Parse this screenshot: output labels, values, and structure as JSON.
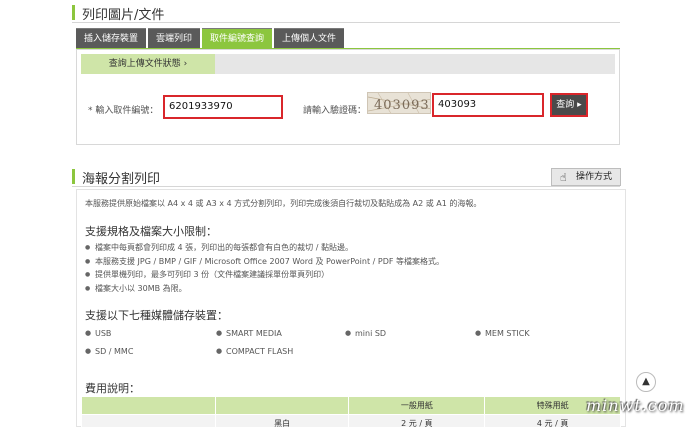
{
  "section1": {
    "title": "列印圖片/文件"
  },
  "tabs": [
    {
      "label": "插入儲存裝置"
    },
    {
      "label": "雲端列印"
    },
    {
      "label": "取件編號查詢"
    },
    {
      "label": "上傳個人文件"
    }
  ],
  "query": {
    "subtab_label": "查詢上傳文件狀態 ›",
    "pickup_label": "* 輸入取件編號：",
    "pickup_value": "6201933970",
    "captcha_label": "請輸入驗證碼：",
    "captcha_text": "403093",
    "captcha_value": "403093",
    "submit_label": "查詢 ▸"
  },
  "section2": {
    "title": "海報分割列印",
    "help_label": "操作方式",
    "help_icon": "hand-pointer-icon"
  },
  "intro_text": "本服務提供原始檔案以 A4 x 4 或 A3 x 4 方式分割列印，列印完成後須自行裁切及黏貼成為 A2 或 A1 的海報。",
  "spec": {
    "heading": "支援規格及檔案大小限制：",
    "items": [
      "檔案中每頁都會列印成 4 張，列印出的每張都會有白色的裁切 / 黏貼邊。",
      "本服務支援 JPG / BMP / GIF / Microsoft Office 2007 Word 及 PowerPoint / PDF 等檔案格式。",
      "提供單機列印，最多可列印 3 份（文件檔案建議採單份單頁列印）",
      "檔案大小以 30MB 為限。"
    ]
  },
  "devices": {
    "heading": "支援以下七種媒體儲存裝置：",
    "items": [
      "USB",
      "SMART MEDIA",
      "mini SD",
      "MEM STICK",
      "SD / MMC",
      "COMPACT FLASH"
    ]
  },
  "fees": {
    "heading": "費用說明：",
    "columns": [
      "",
      "",
      "一般用紙",
      "特殊用紙"
    ],
    "row": [
      "",
      "黑白",
      "2 元 / 頁",
      "4 元 / 頁"
    ]
  },
  "watermark": "minwt.com",
  "scroll_top": "▲"
}
